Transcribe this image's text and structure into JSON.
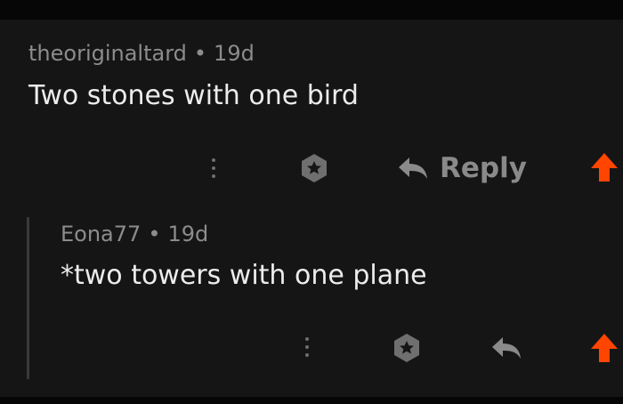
{
  "comments": [
    {
      "author": "theoriginaltard",
      "separator": "•",
      "age": "19d",
      "body": "Two stones with one bird",
      "actions": {
        "more_icon": "more-vertical-icon",
        "award_icon": "award-icon",
        "reply_icon": "reply-arrow-icon",
        "reply_label": "Reply",
        "upvote_icon": "upvote-arrow-icon"
      }
    },
    {
      "author": "Eona77",
      "separator": "•",
      "age": "19d",
      "body": "*two towers with one plane",
      "actions": {
        "more_icon": "more-vertical-icon",
        "award_icon": "award-icon",
        "reply_icon": "reply-arrow-icon",
        "upvote_icon": "upvote-arrow-icon"
      }
    }
  ],
  "colors": {
    "background": "#151516",
    "meta_text": "#8c8c8c",
    "body_text": "#ececec",
    "icon_gray": "#6f6f6f",
    "upvote_orange": "#ff4500",
    "thread_line": "#3a3a3a"
  }
}
